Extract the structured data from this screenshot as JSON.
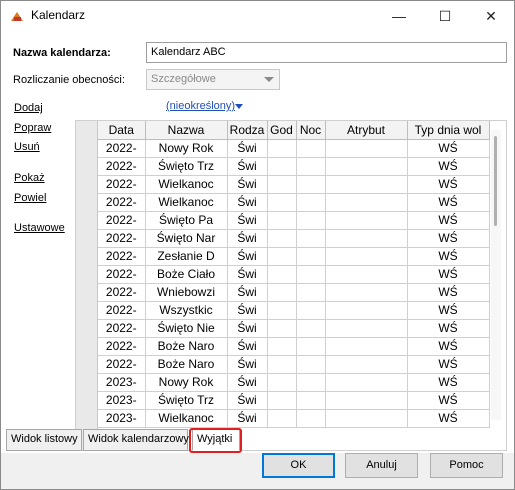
{
  "window": {
    "title": "Kalendarz",
    "minimize_glyph": "—",
    "maximize_glyph": "☐",
    "close_glyph": "✕",
    "icon": "calendar-app-icon"
  },
  "form": {
    "name_label": "Nazwa kalendarza:",
    "name_value": "Kalendarz ABC",
    "attendance_label": "Rozliczanie obecności:",
    "attendance_value": "Szczegółowe"
  },
  "sidebar": {
    "links": [
      "Dodaj",
      "Popraw",
      "Usuń",
      "Pokaż",
      "Powiel",
      "Ustawowe"
    ]
  },
  "filter": {
    "label": "(nieokreślony)"
  },
  "grid": {
    "columns": [
      "Data",
      "Nazwa",
      "Rodza",
      "God",
      "Noc",
      "Atrybut",
      "Typ dnia wol"
    ],
    "rows": [
      [
        "2022-",
        "Nowy Rok",
        "Świ",
        "",
        "",
        "",
        "WŚ"
      ],
      [
        "2022-",
        "Święto Trz",
        "Świ",
        "",
        "",
        "",
        "WŚ"
      ],
      [
        "2022-",
        "Wielkanoc",
        "Świ",
        "",
        "",
        "",
        "WŚ"
      ],
      [
        "2022-",
        "Wielkanoc",
        "Świ",
        "",
        "",
        "",
        "WŚ"
      ],
      [
        "2022-",
        "Święto Pa",
        "Świ",
        "",
        "",
        "",
        "WŚ"
      ],
      [
        "2022-",
        "Święto Nar",
        "Świ",
        "",
        "",
        "",
        "WŚ"
      ],
      [
        "2022-",
        "Zesłanie D",
        "Świ",
        "",
        "",
        "",
        "WŚ"
      ],
      [
        "2022-",
        "Boże Ciało",
        "Świ",
        "",
        "",
        "",
        "WŚ"
      ],
      [
        "2022-",
        "Wniebowzi",
        "Świ",
        "",
        "",
        "",
        "WŚ"
      ],
      [
        "2022-",
        "Wszystkic",
        "Świ",
        "",
        "",
        "",
        "WŚ"
      ],
      [
        "2022-",
        "Święto Nie",
        "Świ",
        "",
        "",
        "",
        "WŚ"
      ],
      [
        "2022-",
        "Boże Naro",
        "Świ",
        "",
        "",
        "",
        "WŚ"
      ],
      [
        "2022-",
        "Boże Naro",
        "Świ",
        "",
        "",
        "",
        "WŚ"
      ],
      [
        "2023-",
        "Nowy Rok",
        "Świ",
        "",
        "",
        "",
        "WŚ"
      ],
      [
        "2023-",
        "Święto Trz",
        "Świ",
        "",
        "",
        "",
        "WŚ"
      ],
      [
        "2023-",
        "Wielkanoc",
        "Świ",
        "",
        "",
        "",
        "WŚ"
      ]
    ]
  },
  "tabs": [
    "Widok listowy",
    "Widok kalendarzowy",
    "Wyjątki"
  ],
  "active_tab": "Wyjątki",
  "buttons": {
    "ok": "OK",
    "cancel": "Anuluj",
    "help": "Pomoc"
  },
  "colors": {
    "highlight": "#e02020",
    "link": "#1f4fbf",
    "accent": "#0078d7"
  }
}
